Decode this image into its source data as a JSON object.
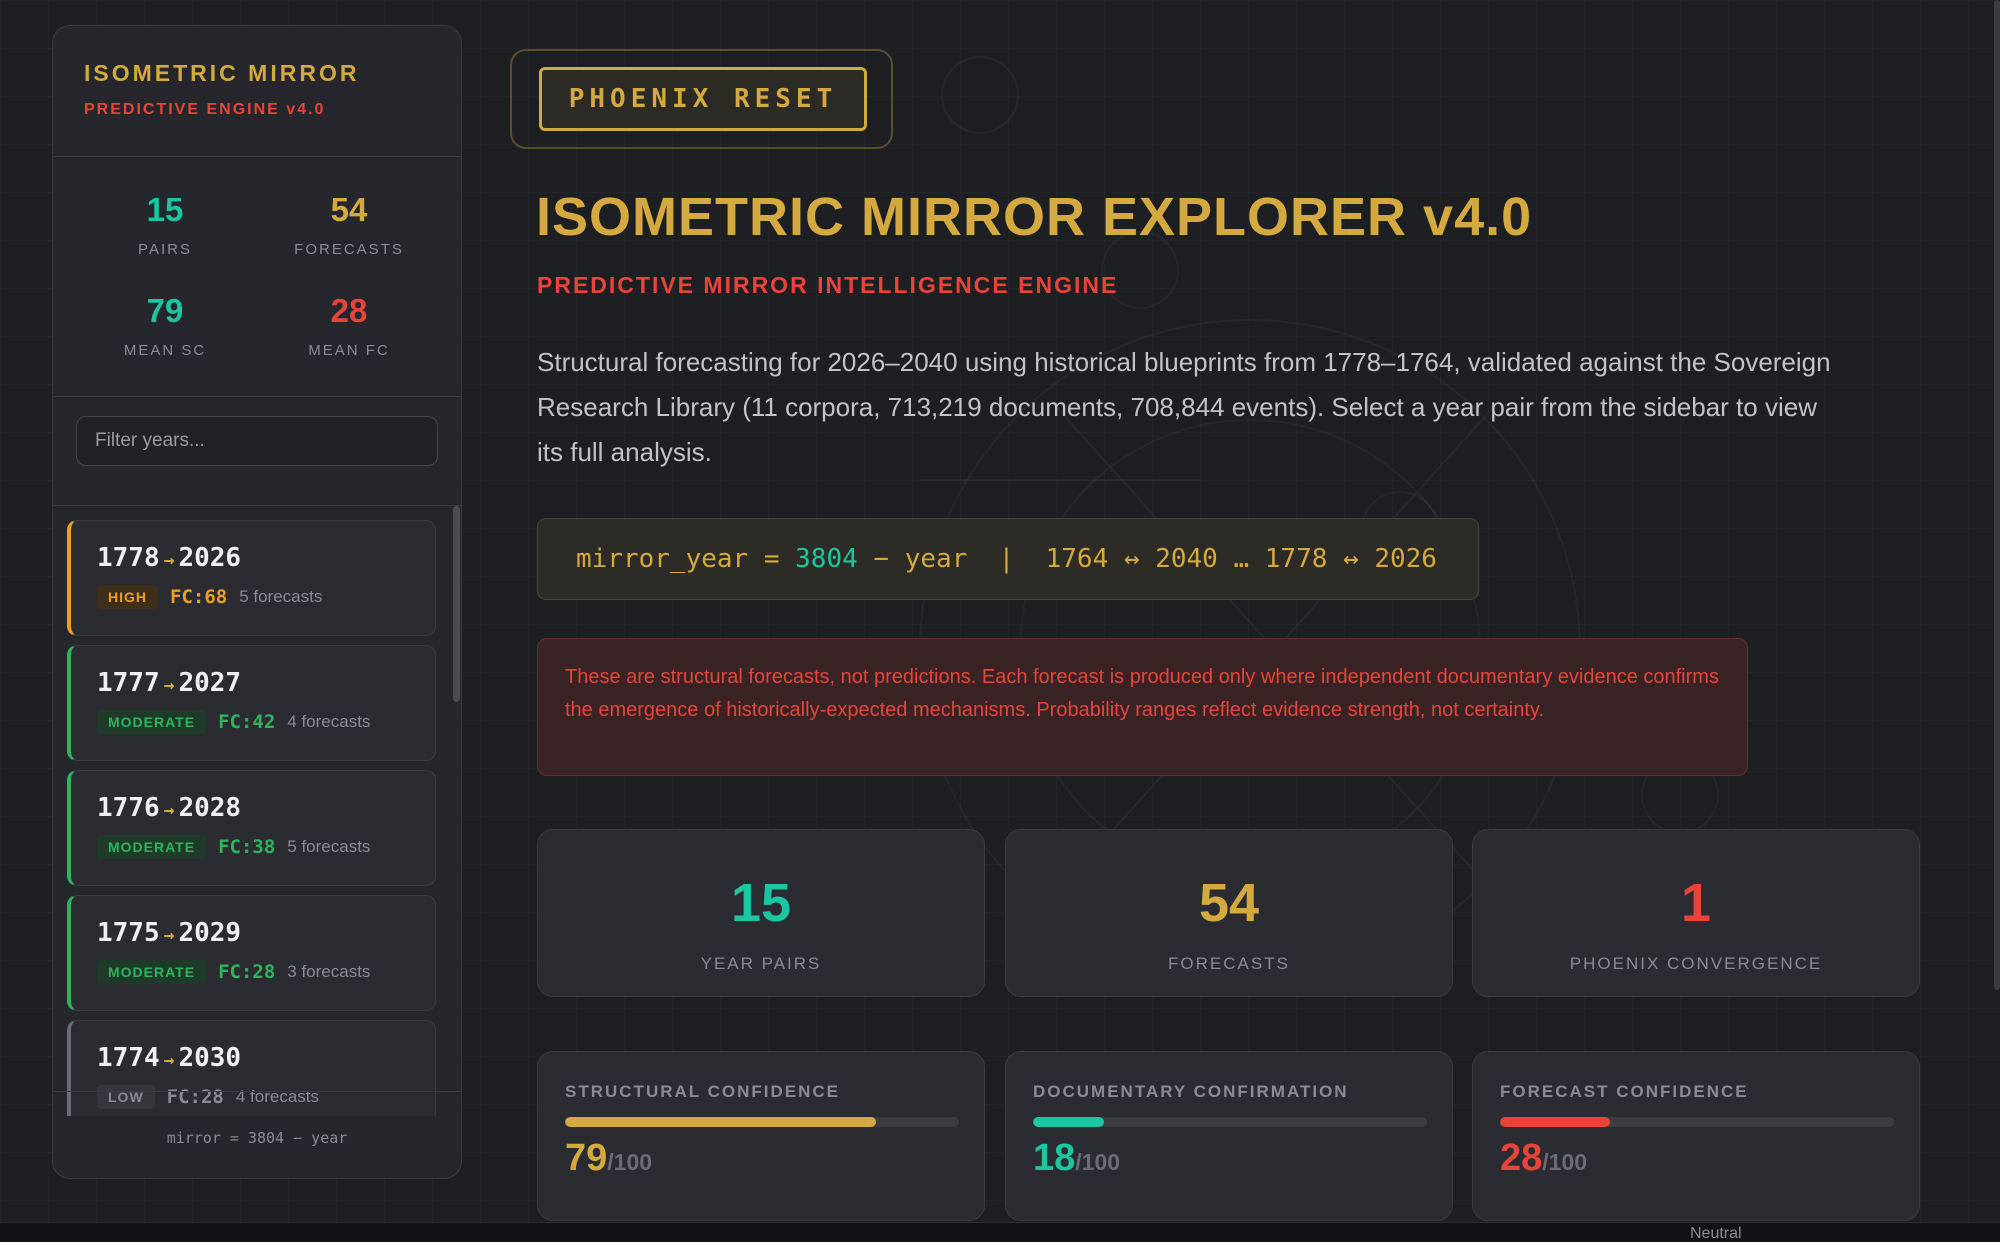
{
  "sidebar": {
    "title": "ISOMETRIC MIRROR",
    "subtitle": "PREDICTIVE ENGINE v4.0",
    "stats": [
      {
        "value": "15",
        "label": "PAIRS",
        "color": "#1cc6a0"
      },
      {
        "value": "54",
        "label": "FORECASTS",
        "color": "#d4a940"
      },
      {
        "value": "79",
        "label": "MEAN SC",
        "color": "#1cc6a0"
      },
      {
        "value": "28",
        "label": "MEAN FC",
        "color": "#e8443a"
      }
    ],
    "filter_placeholder": "Filter years...",
    "pairs": [
      {
        "from": "1778",
        "to": "2026",
        "level": "HIGH",
        "fc": "FC:68",
        "count": "5 forecasts"
      },
      {
        "from": "1777",
        "to": "2027",
        "level": "MODERATE",
        "fc": "FC:42",
        "count": "4 forecasts"
      },
      {
        "from": "1776",
        "to": "2028",
        "level": "MODERATE",
        "fc": "FC:38",
        "count": "5 forecasts"
      },
      {
        "from": "1775",
        "to": "2029",
        "level": "MODERATE",
        "fc": "FC:28",
        "count": "3 forecasts"
      },
      {
        "from": "1774",
        "to": "2030",
        "level": "LOW",
        "fc": "FC:28",
        "count": "4 forecasts"
      }
    ],
    "arrow": "→",
    "footer": "mirror = 3804 − year"
  },
  "main": {
    "phoenix_button": "PHOENIX RESET",
    "title": "ISOMETRIC MIRROR EXPLORER v4.0",
    "subtitle": "PREDICTIVE MIRROR INTELLIGENCE ENGINE",
    "intro": "Structural forecasting for 2026–2040 using historical blueprints from 1778–1764, validated against the Sovereign Research Library (11 corpora, 713,219 documents, 708,844 events). Select a year pair from the sidebar to view its full analysis.",
    "formula": {
      "prefix": "mirror_year = ",
      "constant": "3804",
      "suffix": " − year  |  1764 ↔ 2040 … 1778 ↔ 2026"
    },
    "warning": "These are structural forecasts, not predictions. Each forecast is produced only where independent documentary evidence confirms the emergence of historically-expected mechanisms. Probability ranges reflect evidence strength, not certainty.",
    "stat_cards": [
      {
        "value": "15",
        "label": "YEAR PAIRS",
        "color": "#1cc6a0"
      },
      {
        "value": "54",
        "label": "FORECASTS",
        "color": "#d4a940"
      },
      {
        "value": "1",
        "label": "PHOENIX CONVERGENCE",
        "color": "#e8443a"
      }
    ],
    "confidence_cards": [
      {
        "label": "STRUCTURAL CONFIDENCE",
        "value": "79",
        "max": "/100",
        "fraction": 0.79,
        "color": "#d4a940"
      },
      {
        "label": "DOCUMENTARY CONFIRMATION",
        "value": "18",
        "max": "/100",
        "fraction": 0.18,
        "color": "#1cc6a0"
      },
      {
        "label": "FORECAST CONFIDENCE",
        "value": "28",
        "max": "/100",
        "fraction": 0.28,
        "color": "#e8443a"
      }
    ]
  },
  "bottom": {
    "neutral_label": "Neutral"
  }
}
